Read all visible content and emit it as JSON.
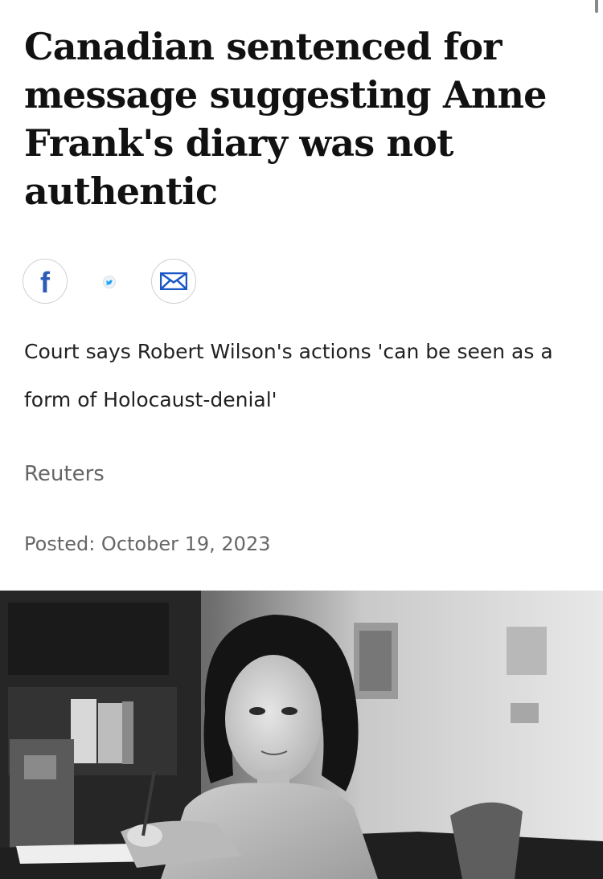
{
  "article": {
    "headline": "Canadian sentenced for message suggesting Anne Frank's diary was not authentic",
    "deck": "Court says Robert Wilson's actions 'can be seen as a form of Holocaust-denial'",
    "byline": "Reuters",
    "posted": "Posted: October 19, 2023"
  },
  "share": {
    "facebook_glyph": "f",
    "icons": [
      "facebook-icon",
      "twitter-icon",
      "email-icon"
    ],
    "colors": {
      "facebook": "#2d5cb8",
      "twitter": "#1da1f2",
      "email": "#1a57c4",
      "border": "#cfcfcf"
    }
  },
  "photo": {
    "style": "black-and-white"
  }
}
